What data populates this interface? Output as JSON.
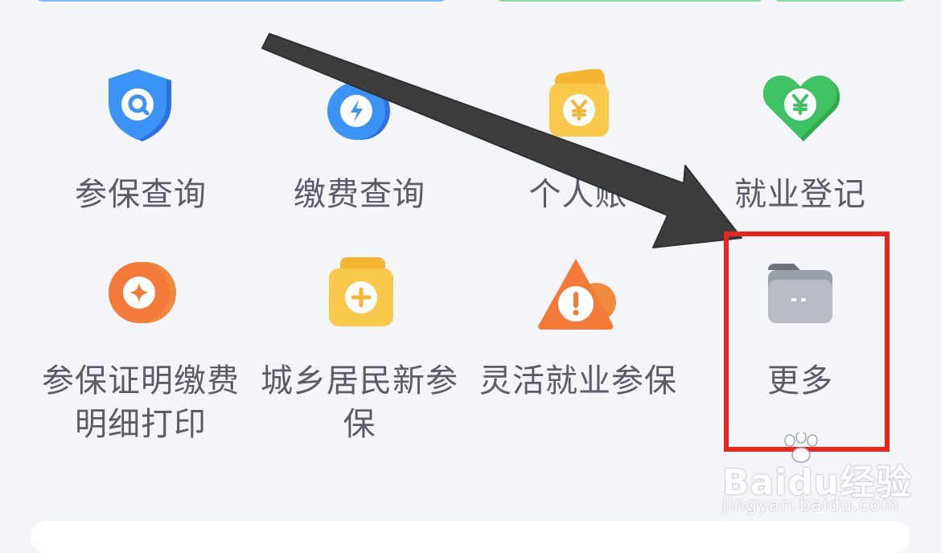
{
  "tiles": [
    {
      "label": "参保查询",
      "icon": "shield-search-icon"
    },
    {
      "label": "缴费查询",
      "icon": "lightning-drop-icon"
    },
    {
      "label": "个人账",
      "icon": "yuan-wallet-icon"
    },
    {
      "label": "就业登记",
      "icon": "yuan-heart-icon"
    },
    {
      "label_lines": [
        "参保证明缴费",
        "明细打印"
      ],
      "icon": "sparkle-coin-icon"
    },
    {
      "label_lines": [
        "城乡居民新参",
        "保"
      ],
      "icon": "plus-folder-icon"
    },
    {
      "label": "灵活就业参保",
      "icon": "warning-triangle-icon"
    },
    {
      "label": "更多",
      "icon": "more-folder-icon"
    }
  ],
  "watermark": {
    "brand": "Baidu经验",
    "url": "jingyan.baidu.com"
  },
  "colors": {
    "highlight": "#e8241f",
    "arrow": "#3d3d3d",
    "background": "#f4f5f9"
  }
}
